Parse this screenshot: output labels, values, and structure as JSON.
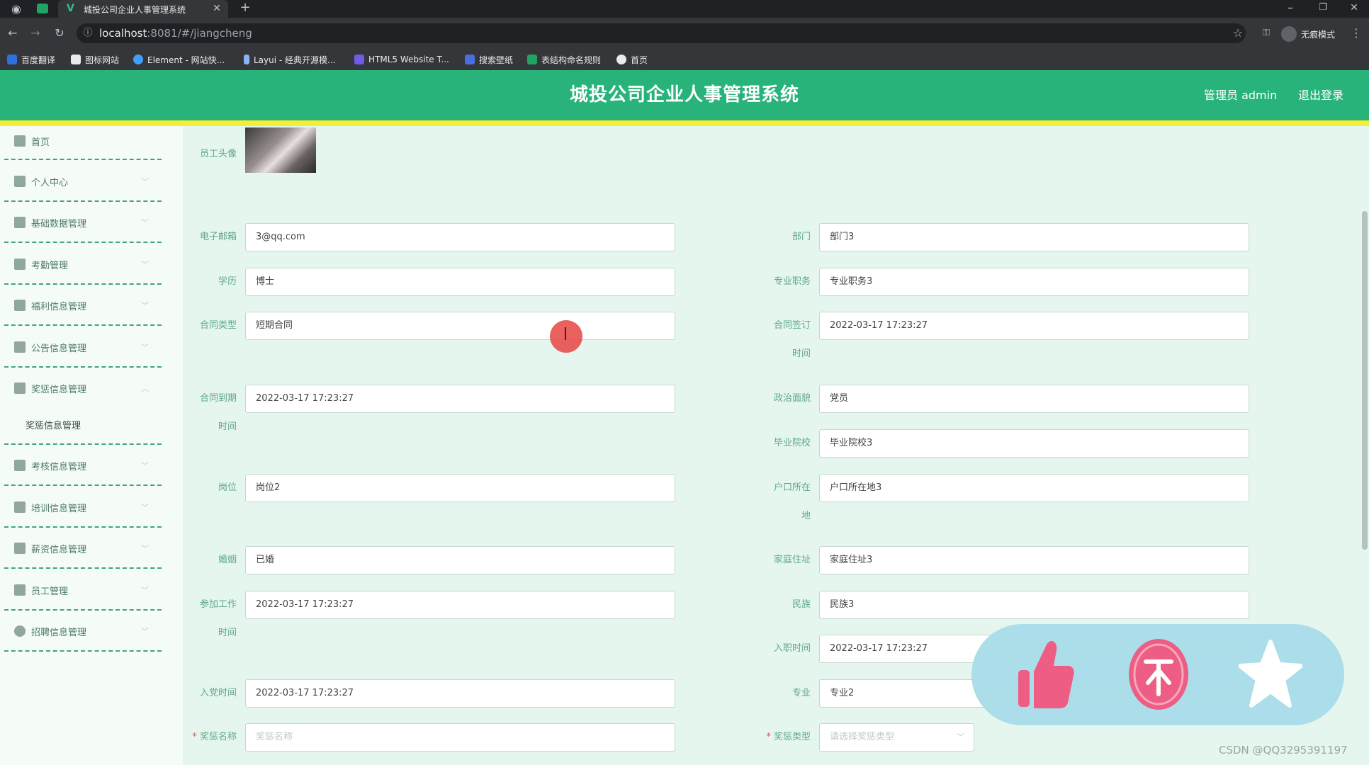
{
  "browser": {
    "tab_title": "城投公司企业人事管理系统",
    "url_host": "localhost",
    "url_rest": ":8081/#/jiangcheng",
    "profile_label": "无痕模式",
    "bookmarks": [
      "百度翻译",
      "图标网站",
      "Element - 网站快...",
      "Layui - 经典开源模...",
      "HTML5 Website T...",
      "搜索壁纸",
      "表结构命名规则",
      "首页"
    ]
  },
  "header": {
    "title": "城投公司企业人事管理系统",
    "user_label": "管理员 admin",
    "logout_label": "退出登录"
  },
  "sidebar": {
    "items": [
      {
        "label": "首页"
      },
      {
        "label": "个人中心"
      },
      {
        "label": "基础数据管理"
      },
      {
        "label": "考勤管理"
      },
      {
        "label": "福利信息管理"
      },
      {
        "label": "公告信息管理"
      },
      {
        "label": "奖惩信息管理"
      },
      {
        "label": "考核信息管理"
      },
      {
        "label": "培训信息管理"
      },
      {
        "label": "薪资信息管理"
      },
      {
        "label": "员工管理"
      },
      {
        "label": "招聘信息管理"
      }
    ],
    "sub_item": "奖惩信息管理"
  },
  "form": {
    "avatar_label": "员工头像",
    "email": {
      "label": "电子邮箱",
      "value": "3@qq.com"
    },
    "department": {
      "label": "部门",
      "value": "部门3"
    },
    "education": {
      "label": "学历",
      "value": "博士"
    },
    "title": {
      "label": "专业职务",
      "value": "专业职务3"
    },
    "contract_type": {
      "label": "合同类型",
      "value": "短期合同"
    },
    "contract_sign": {
      "label_1": "合同签订",
      "label_2": "时间",
      "value": "2022-03-17 17:23:27"
    },
    "contract_end": {
      "label_1": "合同到期",
      "label_2": "时间",
      "value": "2022-03-17 17:23:27"
    },
    "political": {
      "label": "政治面貌",
      "value": "党员"
    },
    "school": {
      "label": "毕业院校",
      "value": "毕业院校3"
    },
    "position": {
      "label": "岗位",
      "value": "岗位2"
    },
    "hukou": {
      "label_1": "户口所在",
      "label_2": "地",
      "value": "户口所在地3"
    },
    "marriage": {
      "label": "婚姻",
      "value": "已婚"
    },
    "address": {
      "label": "家庭住址",
      "value": "家庭住址3"
    },
    "work_start": {
      "label_1": "参加工作",
      "label_2": "时间",
      "value": "2022-03-17 17:23:27"
    },
    "ethnicity": {
      "label": "民族",
      "value": "民族3"
    },
    "hire_date": {
      "label": "入职时间",
      "value": "2022-03-17 17:23:27"
    },
    "party_date": {
      "label": "入党时间",
      "value": "2022-03-17 17:23:27"
    },
    "major": {
      "label": "专业",
      "value": "专业2"
    },
    "reward_name": {
      "label": "奖惩名称",
      "placeholder": "奖惩名称"
    },
    "reward_type": {
      "label": "奖惩类型",
      "placeholder": "请选择奖惩类型"
    }
  },
  "watermark": "CSDN @QQ3295391197",
  "colors": {
    "header": "#27b37a",
    "accent_bar": "#f4ee3a",
    "main_bg": "#e5f6ef",
    "label": "#5fa888"
  }
}
